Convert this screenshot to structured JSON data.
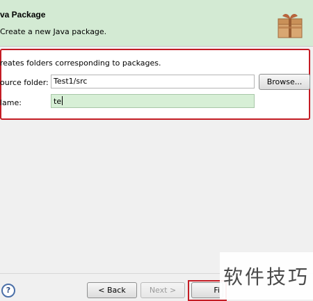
{
  "header": {
    "title": "va Package",
    "description": "Create a new Java package."
  },
  "info_text": "reates folders corresponding to packages.",
  "form": {
    "source_folder_label": "ource folder:",
    "source_folder_value": "Test1/src",
    "browse_label": "Browse...",
    "name_label": "lame:",
    "name_value": "te"
  },
  "buttons": {
    "help": "?",
    "back": "< Back",
    "next": "Next >",
    "finish": "Fi"
  },
  "watermark": "软件技巧",
  "colors": {
    "header_bg": "#d3ead3",
    "highlight_red": "#c41c24",
    "selected_field_bg": "#d7efd6"
  }
}
